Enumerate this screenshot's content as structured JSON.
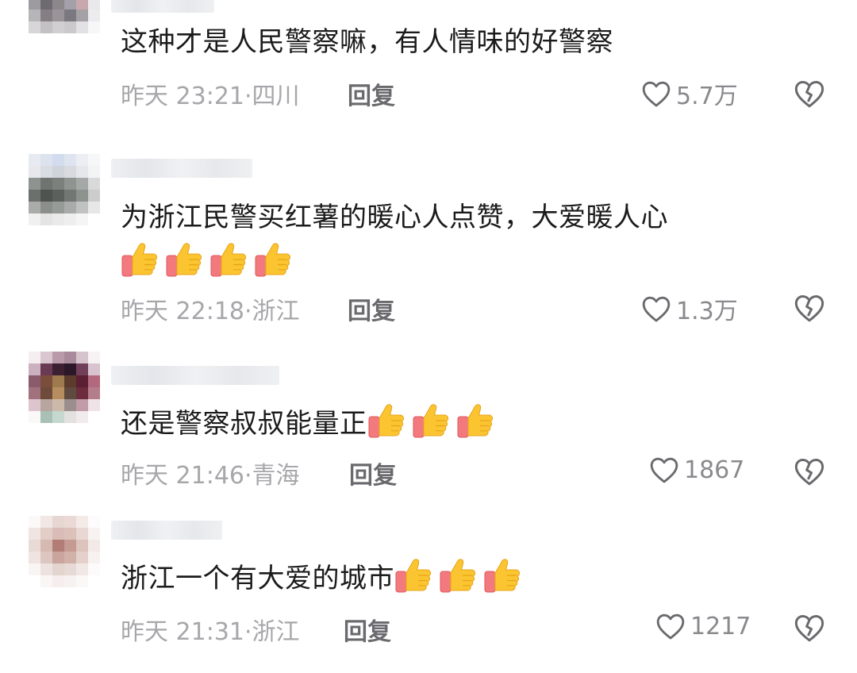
{
  "comments": [
    {
      "text": "这种才是人民警察嘛，有人情味的好警察",
      "thumbs_count": 0,
      "time": "昨天 23:21",
      "location": "四川",
      "reply_label": "回复",
      "likes": "5.7万"
    },
    {
      "text": "为浙江民警买红薯的暖心人点赞，大爱暖人心",
      "thumbs_count": 4,
      "time": "昨天 22:18",
      "location": "浙江",
      "reply_label": "回复",
      "likes": "1.3万"
    },
    {
      "text": "还是警察叔叔能量正",
      "thumbs_count": 3,
      "time": "昨天 21:46",
      "location": "青海",
      "reply_label": "回复",
      "likes": "1867"
    },
    {
      "text": "浙江一个有大爱的城市",
      "thumbs_count": 3,
      "time": "昨天 21:31",
      "location": "浙江",
      "reply_label": "回复",
      "likes": "1217"
    }
  ],
  "icons": {
    "like": "heart-outline-icon",
    "dislike": "broken-heart-icon",
    "thumbs": "thumbs-up-emoji"
  },
  "colors": {
    "meta_text": "#a7a7ab",
    "reply_text": "#6a6a6e",
    "body_text": "#1b1b1b"
  }
}
